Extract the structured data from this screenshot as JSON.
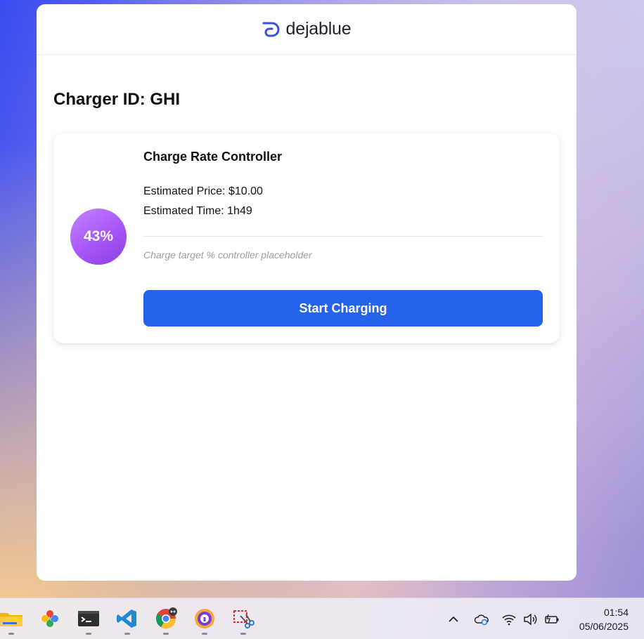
{
  "app": {
    "brand_name": "dejablue",
    "page_title": "Charger ID: GHI"
  },
  "card": {
    "charge_percent_label": "43%",
    "charge_percent": 43,
    "title": "Charge Rate Controller",
    "price_label": "Estimated Price:",
    "price_value": "$10.00",
    "time_label": "Estimated Time:",
    "time_value": "1h49",
    "placeholder": "Charge target % controller placeholder",
    "start_button": "Start Charging"
  },
  "taskbar": {
    "apps": [
      "file-explorer-icon",
      "google-photos-icon",
      "terminal-icon",
      "vscode-icon",
      "chrome-icon",
      "proton-pass-icon",
      "snipping-tool-icon"
    ],
    "tray": [
      "show-hidden-icons-chevron",
      "onedrive-icon",
      "wifi-icon",
      "volume-icon",
      "battery-icon"
    ],
    "time": "01:54",
    "date": "05/06/2025"
  },
  "colors": {
    "accent": "#2563eb",
    "percent_circle": "#a855f7",
    "brand_logo": "#3b4fe0"
  }
}
